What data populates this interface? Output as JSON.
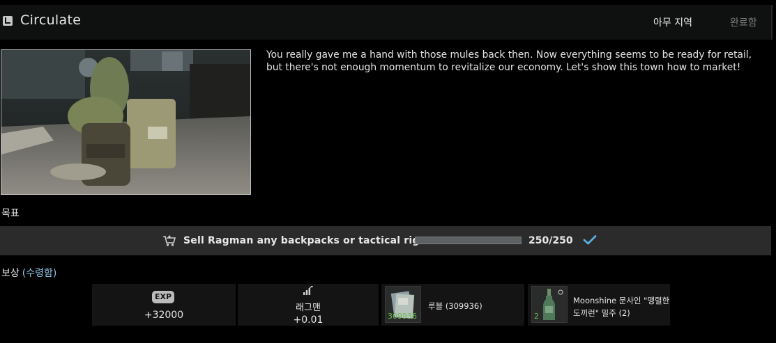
{
  "header": {
    "title": "Circulate",
    "location": "아무 지역",
    "status": "완료함"
  },
  "description": "You really gave me a hand with those mules back then. Now everything seems to be ready for retail, but there's not enough momentum to revitalize our economy. Let's show this town how to market!",
  "objectives": {
    "label": "목표",
    "items": [
      {
        "text": "Sell Ragman any backpacks or tactical rigs",
        "count": "250/250",
        "progress": 1.0,
        "icon": "trader-sell-icon",
        "completed_icon": "checkmark-icon"
      }
    ]
  },
  "rewards": {
    "label": "보상",
    "received_label": "(수령함)",
    "exp": {
      "badge": "EXP",
      "value": "+32000"
    },
    "reputation": {
      "trader": "래그맨",
      "value": "+0.01",
      "icon": "reputation-bars-icon"
    },
    "items": [
      {
        "name": "루블  (309936)",
        "quantity": "309936",
        "icon": "roubles-icon"
      },
      {
        "name": "Moonshine 문사인 \"맹렬한 도끼런\" 밀주  (2)",
        "quantity": "2",
        "icon": "bottle-icon"
      }
    ]
  },
  "colors": {
    "accent_blue": "#8fc6e8",
    "check_blue": "#5ab0e0",
    "quantity_green": "#6cbb52"
  }
}
